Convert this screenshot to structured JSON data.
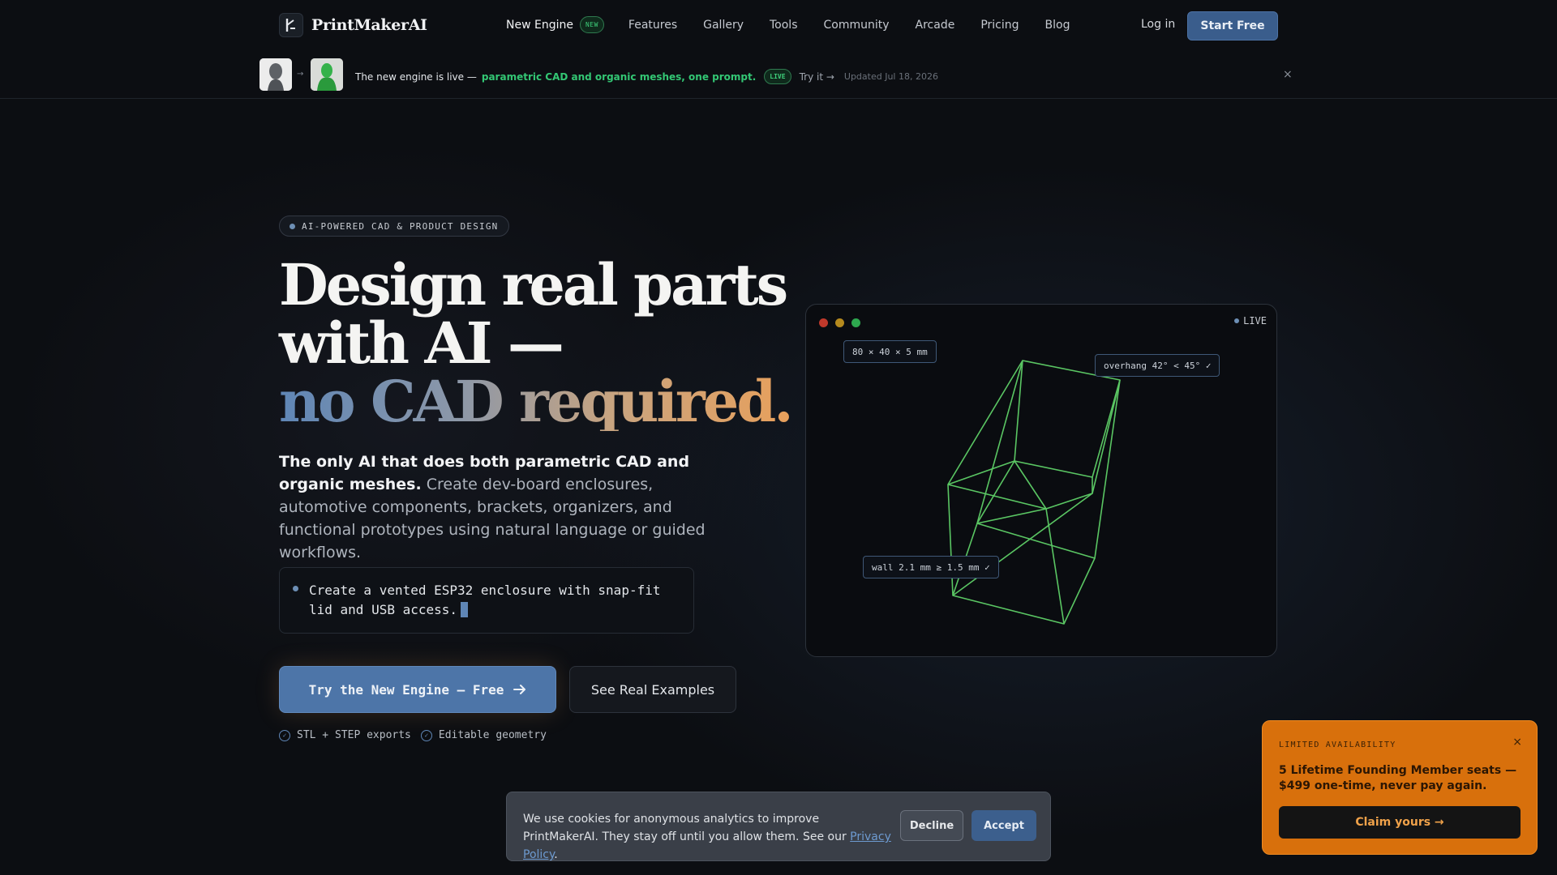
{
  "header": {
    "brand": "PrintMakerAI",
    "nav": {
      "engine": "New Engine",
      "engine_badge": "NEW",
      "items": [
        "Features",
        "Gallery",
        "Tools",
        "Community",
        "Arcade",
        "Pricing",
        "Blog"
      ]
    },
    "login": "Log in",
    "start_free": "Start Free"
  },
  "announcement": {
    "lead": "The new engine is live —",
    "highlight": "parametric CAD and organic meshes, one prompt.",
    "badge": "LIVE",
    "try_it": "Try it →",
    "updated": "Updated Jul 18, 2026",
    "arrow": "→",
    "close": "×"
  },
  "hero": {
    "badge": "AI-POWERED CAD & PRODUCT DESIGN",
    "headline_line1": "Design real parts",
    "headline_line2": "with AI —",
    "headline_line3": "no CAD required.",
    "sub_bold": "The only AI that does both parametric CAD and organic meshes.",
    "sub_rest": " Create dev-board enclosures, automotive components, brackets, organizers, and functional prototypes using natural language or guided workflows.",
    "prompt": "Create a vented ESP32 enclosure with snap-fit lid and USB access.",
    "cta_primary": "Try the New Engine — Free",
    "cta_secondary": "See Real Examples",
    "features": [
      "STL + STEP exports",
      "Editable geometry"
    ]
  },
  "preview": {
    "live": "LIVE",
    "dims": "80 × 40 × 5 mm",
    "overhang": "overhang 42° < 45° ✓",
    "wall": "wall 2.1 mm ≥ 1.5 mm ✓",
    "wire_color": "#5fd068"
  },
  "cookie": {
    "text_before": "We use cookies for anonymous analytics to improve PrintMakerAI. They stay off until you allow them. See our ",
    "link": "Privacy Policy",
    "text_after": ".",
    "decline": "Decline",
    "accept": "Accept"
  },
  "promo": {
    "label": "LIMITED AVAILABILITY",
    "text": "5 Lifetime Founding Member seats — $499 one-time, never pay again.",
    "button": "Claim yours →",
    "close": "×"
  },
  "colors": {
    "accent": "#4d75a8",
    "live_green": "#3ecf7a",
    "promo_orange": "#d8700c"
  }
}
